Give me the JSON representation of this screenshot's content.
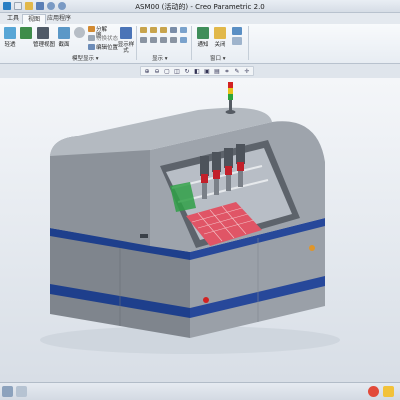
{
  "window": {
    "title": "ASM00 (活动的) - Creo Parametric 2.0"
  },
  "tabs": [
    {
      "label": "工具"
    },
    {
      "label": "视图"
    },
    {
      "label": "应用程序"
    }
  ],
  "ribbon": {
    "items": [
      {
        "label": "轻透"
      },
      {
        "label": "管理视图"
      },
      {
        "label": "截面"
      },
      {
        "label": "分解图"
      },
      {
        "label": "切换状态"
      },
      {
        "label": "编辑位置"
      },
      {
        "label": "显示样式"
      },
      {
        "label": "通知"
      },
      {
        "label": "关闭"
      }
    ],
    "groups": [
      {
        "label": "模型显示 ▾"
      },
      {
        "label": "显示 ▾"
      },
      {
        "label": "窗口 ▾"
      }
    ]
  },
  "colors": {
    "machine_body": "#8c929a",
    "machine_base": "#1e3f8c",
    "bed": "#e05566",
    "signal_red": "#d22222",
    "signal_yellow": "#e8c21a",
    "signal_green": "#2ca43a"
  }
}
